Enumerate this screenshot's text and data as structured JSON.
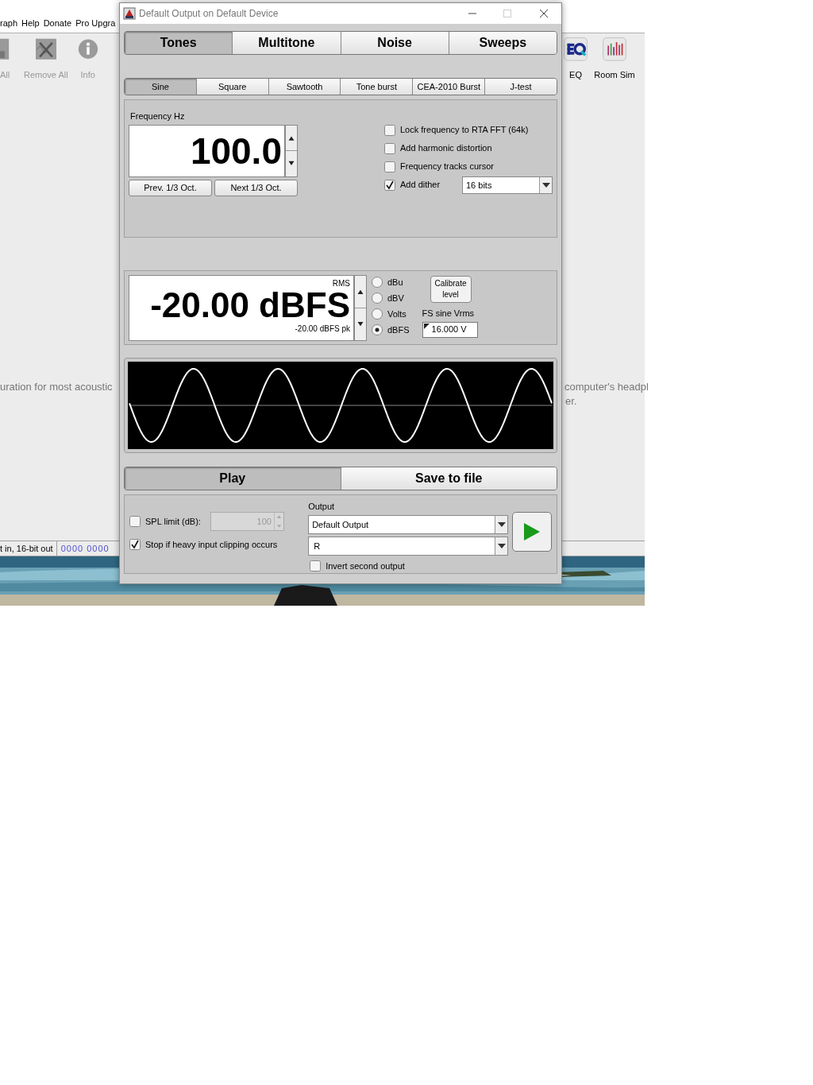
{
  "app": {
    "menu": [
      "raph",
      "Help",
      "Donate",
      "Pro Upgra"
    ],
    "toolbar_left": [
      {
        "label": "All"
      },
      {
        "label": "Remove All"
      },
      {
        "label": "Info"
      }
    ],
    "toolbar_right": [
      {
        "label": "EQ"
      },
      {
        "label": "Room Sim"
      }
    ],
    "text_left": "uration for most acoustic",
    "text_right": [
      "computer's headpl",
      "er."
    ],
    "status": [
      "t in, 16-bit out",
      "0000 0000"
    ]
  },
  "window": {
    "title": "Default Output on Default Device"
  },
  "main_tabs": [
    {
      "label": "Tones",
      "selected": true
    },
    {
      "label": "Multitone",
      "selected": false
    },
    {
      "label": "Noise",
      "selected": false
    },
    {
      "label": "Sweeps",
      "selected": false
    }
  ],
  "wave_tabs": [
    {
      "label": "Sine",
      "selected": true
    },
    {
      "label": "Square",
      "selected": false
    },
    {
      "label": "Sawtooth",
      "selected": false
    },
    {
      "label": "Tone burst",
      "selected": false
    },
    {
      "label": "CEA-2010 Burst",
      "selected": false
    },
    {
      "label": "J-test",
      "selected": false
    }
  ],
  "frequency": {
    "label": "Frequency Hz",
    "value": "100.0"
  },
  "octave_buttons": [
    "Prev. 1/3 Oct.",
    "Next 1/3 Oct."
  ],
  "options": [
    {
      "label": "Lock frequency to RTA FFT (64k)",
      "checked": false
    },
    {
      "label": "Add harmonic distortion",
      "checked": false
    },
    {
      "label": "Frequency tracks cursor",
      "checked": false
    },
    {
      "label": "Add dither",
      "checked": true
    }
  ],
  "dither": {
    "value": "16 bits"
  },
  "level": {
    "value": "-20.00 dBFS",
    "rms": "RMS",
    "peak": "-20.00 dBFS pk"
  },
  "units": [
    {
      "label": "dBu",
      "selected": false
    },
    {
      "label": "dBV",
      "selected": false
    },
    {
      "label": "Volts",
      "selected": false
    },
    {
      "label": "dBFS",
      "selected": true
    }
  ],
  "calibrate": "Calibrate level",
  "fs": {
    "label": "FS sine Vrms",
    "value": "16.000 V"
  },
  "play_tabs": [
    {
      "label": "Play",
      "selected": true
    },
    {
      "label": "Save to file",
      "selected": false
    }
  ],
  "spl": {
    "label": "SPL limit (dB):",
    "checked": false,
    "value": "100",
    "disabled": true
  },
  "clipping": {
    "label": "Stop if heavy input clipping occurs",
    "checked": true
  },
  "output": {
    "label": "Output",
    "device": "Default Output",
    "channel": "R"
  },
  "invert": {
    "label": "Invert second output",
    "checked": false
  }
}
